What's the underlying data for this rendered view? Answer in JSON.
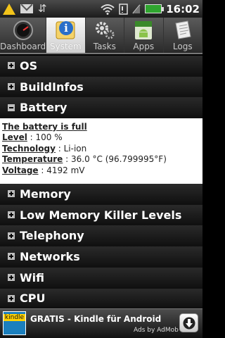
{
  "status_bar": {
    "time": "16:02",
    "icons": [
      "warning-icon",
      "mail-icon",
      "usb-icon",
      "wifi-icon",
      "sd-card-icon",
      "signal-icon",
      "battery-icon"
    ]
  },
  "tabs": [
    {
      "label": "Dashboard",
      "icon": "gauge-icon",
      "active": false
    },
    {
      "label": "System",
      "icon": "info-icon",
      "active": true
    },
    {
      "label": "Tasks",
      "icon": "gears-icon",
      "active": false
    },
    {
      "label": "Apps",
      "icon": "android-icon",
      "active": false
    },
    {
      "label": "Logs",
      "icon": "document-icon",
      "active": false
    }
  ],
  "groups": [
    {
      "label": "OS",
      "expanded": false
    },
    {
      "label": "BuildInfos",
      "expanded": false
    },
    {
      "label": "Battery",
      "expanded": true
    },
    {
      "label": "Memory",
      "expanded": false
    },
    {
      "label": "Low Memory Killer Levels",
      "expanded": false
    },
    {
      "label": "Telephony",
      "expanded": false
    },
    {
      "label": "Networks",
      "expanded": false
    },
    {
      "label": "Wifi",
      "expanded": false
    },
    {
      "label": "CPU",
      "expanded": false
    }
  ],
  "battery_details": {
    "status": "The battery is full",
    "level_key": "Level",
    "level_value": " : 100 %",
    "technology_key": "Technology",
    "technology_value": " : Li-ion",
    "temperature_key": "Temperature",
    "temperature_value": " : 36.0 °C (96.799995°F)",
    "voltage_key": "Voltage",
    "voltage_value": " : 4192 mV"
  },
  "ad": {
    "thumbnail_text": "kindle",
    "title": "GRATIS - Kindle für Android",
    "subtitle": "Ads by AdMob"
  },
  "colors": {
    "accent_green": "#2fa52f",
    "tab_active_bg": "#e6e6e6",
    "group_bg": "#1a1a1a"
  }
}
